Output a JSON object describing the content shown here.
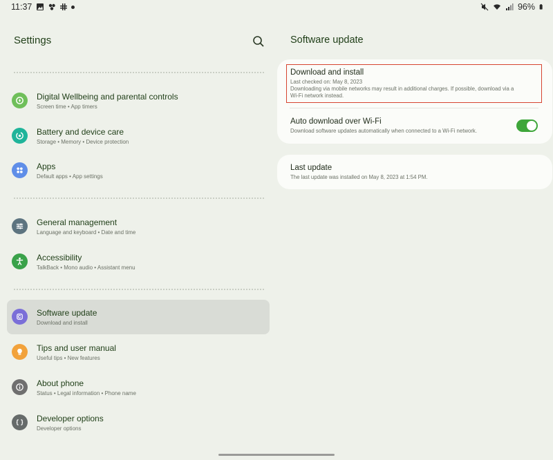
{
  "status_bar": {
    "time": "11:37",
    "battery": "96%",
    "left_icons": [
      "gallery-icon",
      "slack-icon",
      "grid-icon",
      "dot-icon"
    ],
    "right_icons": [
      "mute-icon",
      "wifi-icon",
      "signal-icon",
      "battery-icon"
    ]
  },
  "left": {
    "title": "Settings",
    "items": [
      {
        "label": "Digital Wellbeing and parental controls",
        "sub": "Screen time  •  App timers",
        "icon": "wellbeing-icon",
        "color": "#6fbf5a"
      },
      {
        "label": "Battery and device care",
        "sub": "Storage  •  Memory  •  Device protection",
        "icon": "device-care-icon",
        "color": "#1fb49a"
      },
      {
        "label": "Apps",
        "sub": "Default apps  •  App settings",
        "icon": "apps-icon",
        "color": "#5f8ee8"
      },
      {
        "label": "General management",
        "sub": "Language and keyboard  •  Date and time",
        "icon": "sliders-icon",
        "color": "#5d7480"
      },
      {
        "label": "Accessibility",
        "sub": "TalkBack  •  Mono audio  •  Assistant menu",
        "icon": "accessibility-icon",
        "color": "#3aa24a"
      },
      {
        "label": "Software update",
        "sub": "Download and install",
        "icon": "software-update-icon",
        "color": "#7b6fd8"
      },
      {
        "label": "Tips and user manual",
        "sub": "Useful tips  •  New features",
        "icon": "tips-icon",
        "color": "#f2a23b"
      },
      {
        "label": "About phone",
        "sub": "Status  •  Legal information  •  Phone name",
        "icon": "info-icon",
        "color": "#6f6f6f"
      },
      {
        "label": "Developer options",
        "sub": "Developer options",
        "icon": "developer-icon",
        "color": "#666b6a"
      }
    ]
  },
  "right": {
    "title": "Software update",
    "download": {
      "title": "Download and install",
      "line1": "Last checked on: May 8, 2023",
      "line2": "Downloading via mobile networks may result in additional charges. If possible, download via a",
      "line3": "Wi-Fi network instead."
    },
    "auto": {
      "title": "Auto download over Wi-Fi",
      "sub": "Download software updates automatically when connected to a Wi-Fi network.",
      "enabled": true
    },
    "last": {
      "title": "Last update",
      "sub": "The last update was installed on May 8, 2023 at 1:54 PM."
    }
  },
  "colors": {
    "background": "#eef1ea",
    "accent_green": "#3ea63a",
    "highlight": "#d6432f",
    "selected": "#d9dcd6"
  }
}
